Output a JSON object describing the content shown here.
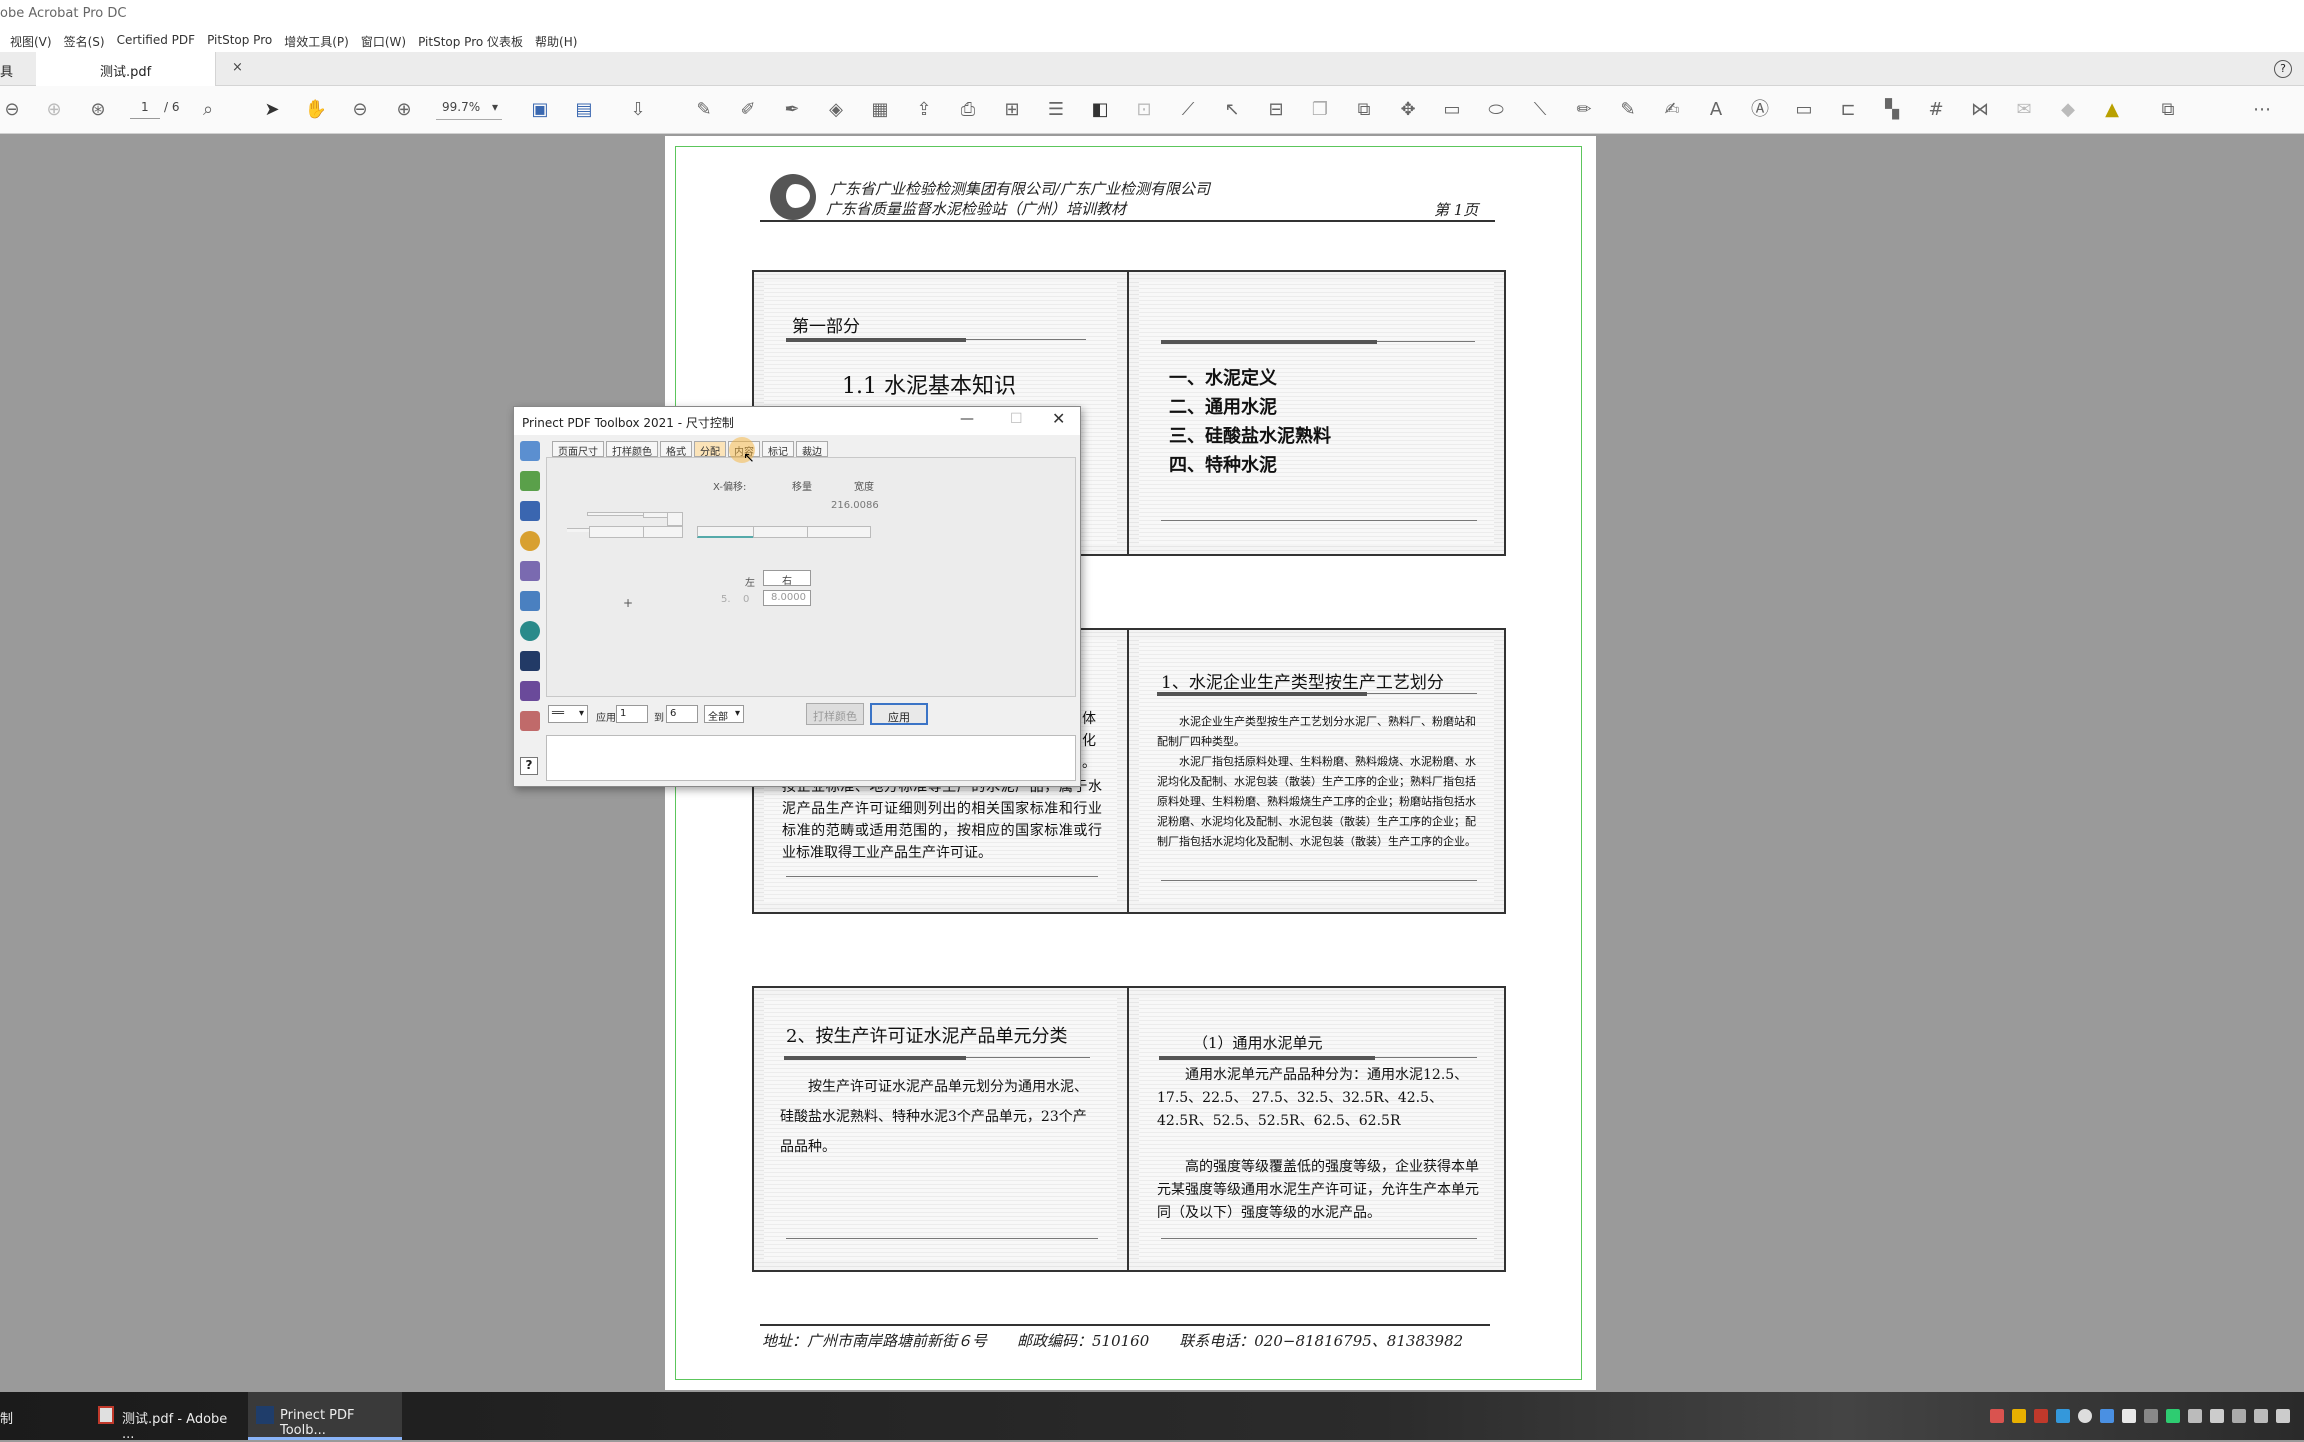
{
  "app": {
    "title": "obe Acrobat Pro DC"
  },
  "menu": [
    "视图(V)",
    "签名(S)",
    "Certified PDF",
    "PitStop Pro",
    "增效工具(P)",
    "窗口(W)",
    "PitStop Pro 仪表板",
    "帮助(H)"
  ],
  "tabs": {
    "left_label": "具",
    "file_tab": "测试.pdf",
    "close": "×",
    "help": "?"
  },
  "toolbar": {
    "page_current": "1",
    "page_total": "/ 6",
    "zoom": "99.7%"
  },
  "pdf": {
    "header_line1": "广东省广业检验检测集团有限公司/广东广业检测有限公司",
    "header_line2": "广东省质量监督水泥检验站（广州）培训教材",
    "page_label": "第 1页",
    "slide1": {
      "part": "第一部分",
      "title": "1.1 水泥基本知识"
    },
    "slide2": {
      "items": [
        "一、水泥定义",
        "二、通用水泥",
        "三、硅酸盐水泥熟料",
        "四、特种水泥"
      ]
    },
    "slide3": {
      "side_chars": [
        "体",
        "化",
        "。"
      ],
      "text": "按企业标准、地方标准等生产的水泥产品，属于水泥产品生产许可证细则列出的相关国家标准和行业标准的范畴或适用范围的，按相应的国家标准或行业标准取得工业产品生产许可证。"
    },
    "slide4": {
      "title": "1、水泥企业生产类型按生产工艺划分",
      "p1": "水泥企业生产类型按生产工艺划分水泥厂、熟料厂、粉磨站和配制厂四种类型。",
      "p2": "水泥厂指包括原料处理、生料粉磨、熟料煅烧、水泥粉磨、水泥均化及配制、水泥包装（散装）生产工序的企业；熟料厂指包括原料处理、生料粉磨、熟料煅烧生产工序的企业；粉磨站指包括水泥粉磨、水泥均化及配制、水泥包装（散装）生产工序的企业；配制厂指包括水泥均化及配制、水泥包装（散装）生产工序的企业。"
    },
    "slide5": {
      "title": "2、按生产许可证水泥产品单元分类",
      "text": "按生产许可证水泥产品单元划分为通用水泥、硅酸盐水泥熟料、特种水泥3个产品单元，23个产品品种。"
    },
    "slide6": {
      "title": "（1）通用水泥单元",
      "p1": "通用水泥单元产品品种分为：通用水泥12.5、17.5、22.5、 27.5、32.5、32.5R、42.5、 42.5R、52.5、52.5R、62.5、62.5R",
      "p2": "高的强度等级覆盖低的强度等级，企业获得本单元某强度等级通用水泥生产许可证，允许生产本单元同（及以下）强度等级的水泥产品。"
    },
    "footer": "地址：广州市南岸路塘前新街６号　　邮政编码：510160　　联系电话：020−81816795、81383982"
  },
  "dialog": {
    "title": "Prinect PDF Toolbox 2021 - 尺寸控制",
    "tabs": [
      "页面尺寸",
      "打样颜色",
      "格式",
      "分配",
      "内容",
      "标记",
      "裁边"
    ],
    "labels": {
      "x_offset": "X-偏移:",
      "move": "移量",
      "width": "宽度",
      "width_value": "216.0086",
      "left": "左",
      "right": "右",
      "field_a": "5.",
      "field_a2": "0",
      "field_b": "8.0000",
      "plus": "+"
    },
    "bottom": {
      "select1": "══",
      "apply_label": "应用",
      "from": "1",
      "to_label": "到",
      "to": "6",
      "scope": "全部",
      "proof_button": "打样颜色",
      "apply_button": "应用"
    },
    "help": "?"
  },
  "taskbar": {
    "left_item": "制",
    "acrobat": "测试.pdf - Adobe ...",
    "prinect": "Prinect PDF Toolb..."
  }
}
